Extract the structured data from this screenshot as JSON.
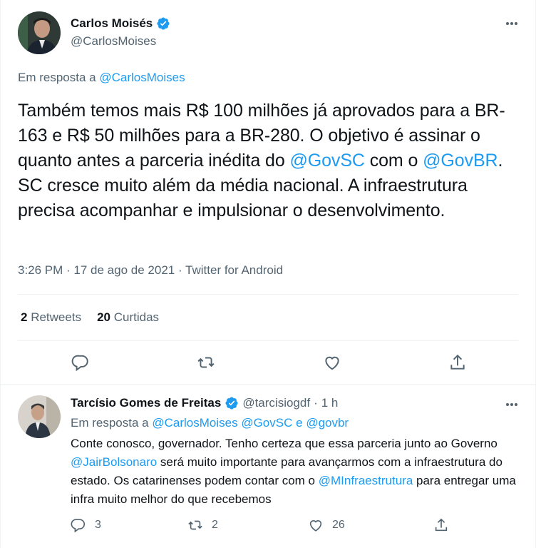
{
  "main_tweet": {
    "author_name": "Carlos Moisés",
    "author_handle": "@CarlosMoises",
    "reply_prefix": "Em resposta a",
    "reply_to": "@CarlosMoises",
    "text_parts": [
      "Também temos mais R$ 100 milhões já aprovados para a BR-163 e R$ 50 milhões para a BR-280. O objetivo é assinar o quanto antes a parceria inédita do ",
      "@GovSC",
      " com o ",
      "@GovBR",
      ". SC cresce muito além da média nacional. A infraestrutura precisa acompanhar e impulsionar o desenvolvimento."
    ],
    "time": "3:26 PM",
    "date": "17 de ago de 2021",
    "source": "Twitter for Android",
    "retweets_count": "2",
    "retweets_label": "Retweets",
    "likes_count": "20",
    "likes_label": "Curtidas"
  },
  "reply_tweet": {
    "author_name": "Tarcísio Gomes de Freitas",
    "author_handle": "@tarcisiogdf",
    "time_ago": "1 h",
    "reply_prefix": "Em resposta a",
    "reply_to_1": "@CarlosMoises",
    "reply_to_2": "@GovSC",
    "reply_conj": "e",
    "reply_to_3": "@govbr",
    "text_parts": [
      "Conte conosco, governador. Tenho certeza que essa parceria junto ao Governo ",
      "@JairBolsonaro",
      " será muito importante para avançarmos com a infraestrutura do estado. Os catarinenses podem contar com o ",
      "@MInfraestrutura",
      " para entregar uma infra muito melhor do que recebemos"
    ],
    "replies_count": "3",
    "retweets_count": "2",
    "likes_count": "26"
  },
  "icons": [
    "verified-badge-icon",
    "more-icon",
    "reply-icon",
    "retweet-icon",
    "like-icon",
    "share-icon"
  ],
  "colors": {
    "accent": "#1d9bf0",
    "muted": "#536471",
    "text": "#0f1419",
    "divider": "#eff3f4"
  }
}
